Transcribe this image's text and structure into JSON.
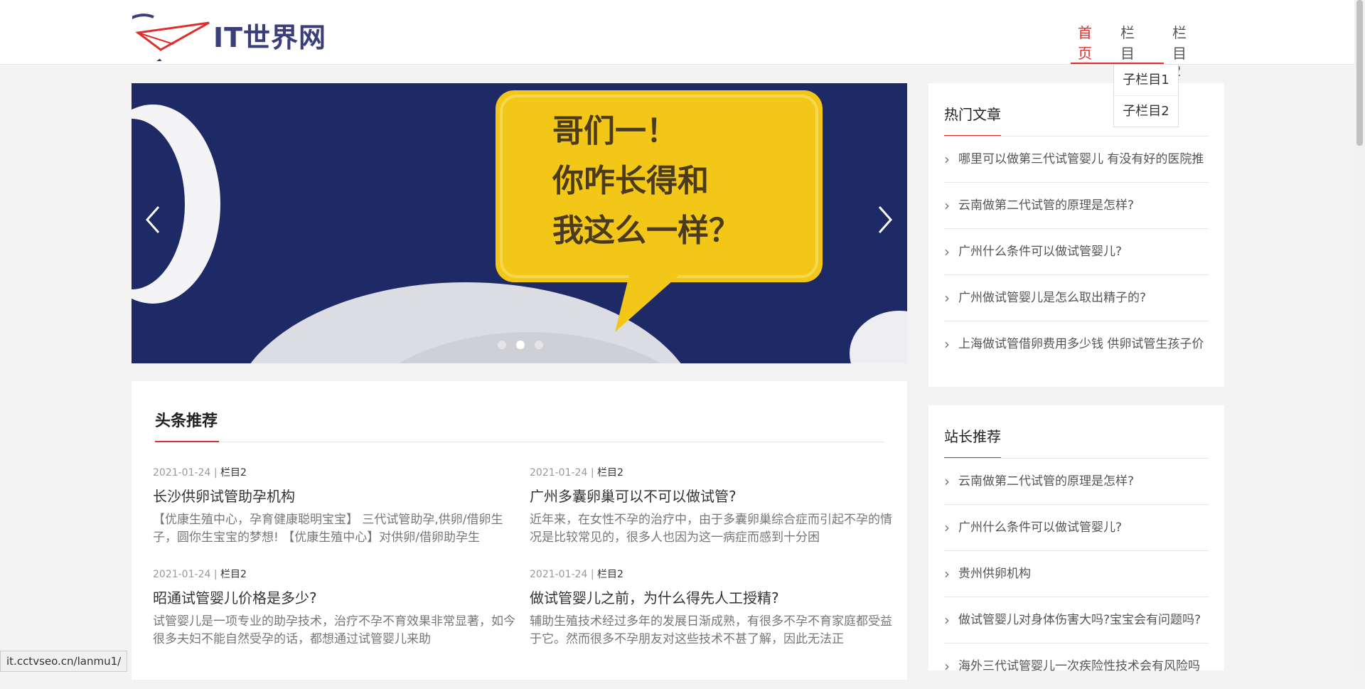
{
  "site": {
    "logo_text": "IT世界网"
  },
  "nav": {
    "items": [
      {
        "label": "首页"
      },
      {
        "label": "栏目1"
      },
      {
        "label": "栏目2"
      }
    ],
    "dropdown": [
      {
        "label": "子栏目1"
      },
      {
        "label": "子栏目2"
      }
    ]
  },
  "carousel": {
    "bubble_text": [
      "哥们一！",
      "你咋长得和",
      "我这么一样？"
    ],
    "slides_total": 3,
    "active_index": 1
  },
  "headlines": {
    "title": "头条推荐",
    "items": [
      {
        "date": "2021-01-24",
        "category": "栏目2",
        "title": "长沙供卵试管助孕机构",
        "desc": "【优康生殖中心，孕育健康聪明宝宝】 三代试管助孕,供卵/借卵生子，圆你生宝宝的梦想! 【优康生殖中心】对供卵/借卵助孕生"
      },
      {
        "date": "2021-01-24",
        "category": "栏目2",
        "title": "广州多囊卵巢可以不可以做试管?",
        "desc": "近年来，在女性不孕的治疗中，由于多囊卵巢综合症而引起不孕的情况是比较常见的，很多人也因为这一病症而感到十分困"
      },
      {
        "date": "2021-01-24",
        "category": "栏目2",
        "title": "昭通试管婴儿价格是多少?",
        "desc": "试管婴儿是一项专业的助孕技术，治疗不孕不育效果非常显著，如今很多夫妇不能自然受孕的话，都想通过试管婴儿来助"
      },
      {
        "date": "2021-01-24",
        "category": "栏目2",
        "title": "做试管婴儿之前，为什么得先人工授精?",
        "desc": "辅助生殖技术经过多年的发展日渐成熟，有很多不孕不育家庭都受益于它。然而很多不孕朋友对这些技术不甚了解，因此无法正"
      }
    ]
  },
  "hot": {
    "title": "热门文章",
    "items": [
      {
        "label": "哪里可以做第三代试管婴儿 有没有好的医院推"
      },
      {
        "label": "云南做第二代试管的原理是怎样?"
      },
      {
        "label": "广州什么条件可以做试管婴儿?"
      },
      {
        "label": "广州做试管婴儿是怎么取出精子的?"
      },
      {
        "label": "上海做试管借卵费用多少钱 供卵试管生孩子价"
      }
    ]
  },
  "admin": {
    "title": "站长推荐",
    "items": [
      {
        "label": "云南做第二代试管的原理是怎样?"
      },
      {
        "label": "广州什么条件可以做试管婴儿?"
      },
      {
        "label": "贵州供卵机构"
      },
      {
        "label": "做试管婴儿对身体伤害大吗?宝宝会有问题吗?"
      },
      {
        "label": "海外三代试管婴儿一次疾险性技术会有风险吗"
      }
    ]
  },
  "status_url": "it.cctvseo.cn/lanmu1/",
  "colors": {
    "accent": "#e02d2d",
    "logo_blue": "#3a3f7a",
    "carousel_bg": "#1d2a66",
    "bubble_yellow": "#f2c718"
  }
}
